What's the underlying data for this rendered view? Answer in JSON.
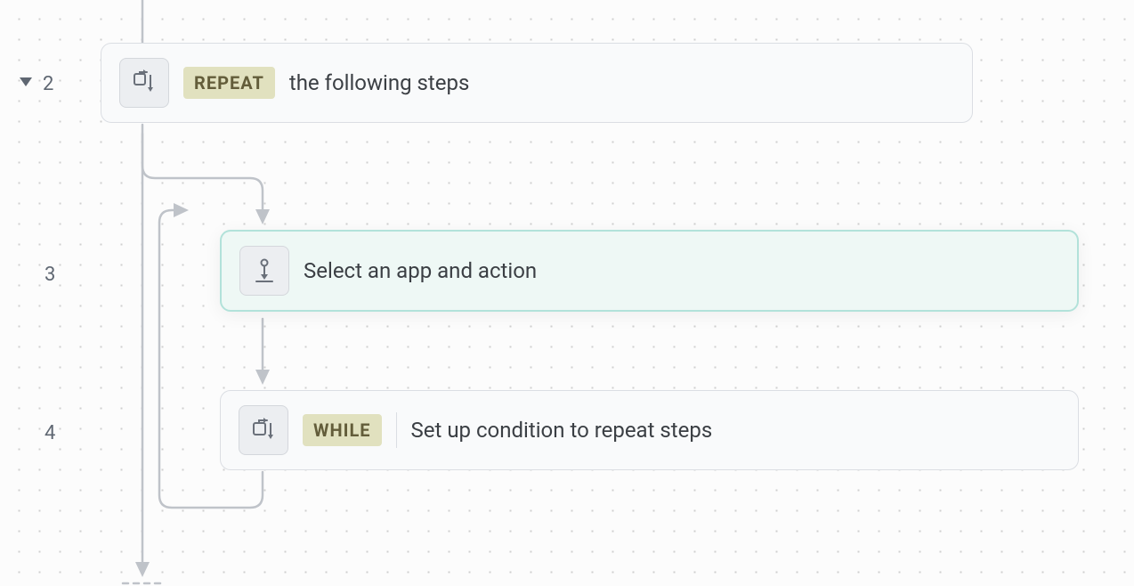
{
  "steps": {
    "repeat": {
      "number": "2",
      "badge": "REPEAT",
      "text": "the following steps",
      "icon": "repeat-icon"
    },
    "select": {
      "number": "3",
      "text": "Select an app and action",
      "icon": "pin-down-icon"
    },
    "while": {
      "number": "4",
      "badge": "WHILE",
      "text": "Set up condition to repeat steps",
      "icon": "repeat-end-icon"
    }
  },
  "colors": {
    "badge_bg": "#e1e1bf",
    "badge_fg": "#635d3a",
    "selected_border": "#b2e2da",
    "selected_bg": "#eef8f5"
  }
}
